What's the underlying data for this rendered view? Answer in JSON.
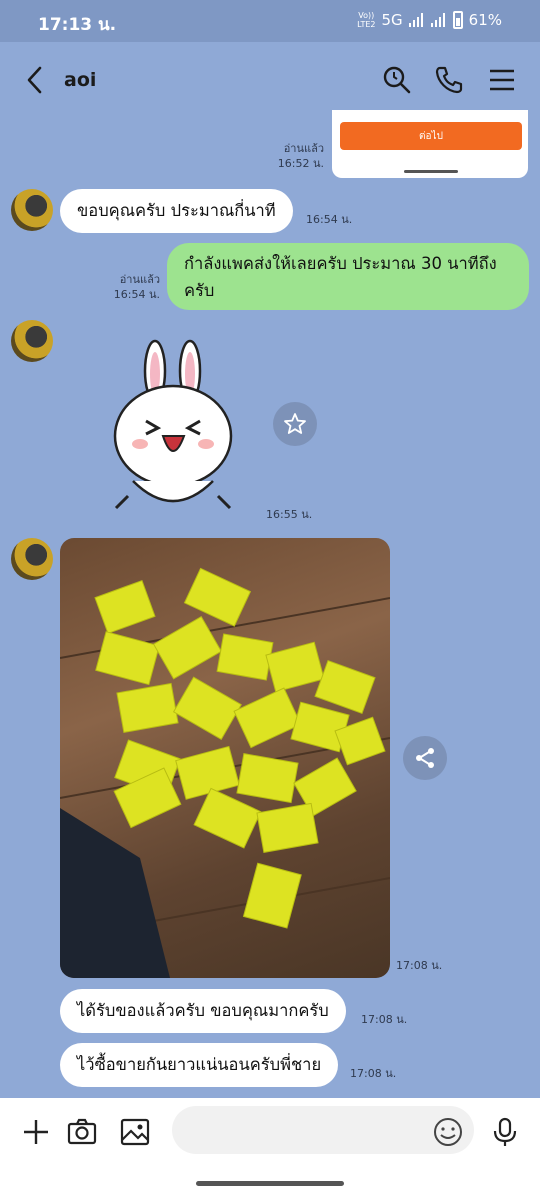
{
  "status_bar": {
    "time": "17:13 น.",
    "volte": "Vo))",
    "lte": "LTE2",
    "network": "5G",
    "battery": "61%"
  },
  "header": {
    "title": "aoi"
  },
  "popup": {
    "button_label": "ต่อไป"
  },
  "messages": [
    {
      "meta_read": "อ่านแล้ว",
      "meta_time": "16:52 น."
    },
    {
      "text": "ขอบคุณครับ ประมาณกี่นาที",
      "time": "16:54 น."
    },
    {
      "text_line1": "กำลังแพคส่งให้เลยครับ ประมาณ 30 นาทีถึง",
      "text_line2": "ครับ",
      "read": "อ่านแล้ว",
      "time": "16:54 น."
    },
    {
      "time": "16:55 น."
    },
    {
      "time": "17:08 น."
    },
    {
      "text": "ได้รับของแล้วครับ ขอบคุณมากครับ",
      "time": "17:08 น."
    },
    {
      "text": "ไว้ซื้อขายกันยาวแน่นอนครับพี่ชาย",
      "time": "17:08 น."
    }
  ],
  "input_bar": {
    "placeholder": ""
  },
  "colors": {
    "chat_background": "#8fa9d6",
    "incoming_bubble": "#ffffff",
    "outgoing_bubble": "#9de38f",
    "accent_orange": "#f26a21"
  },
  "icons": [
    "back-icon",
    "search-icon",
    "phone-icon",
    "menu-icon",
    "star-icon",
    "share-icon",
    "plus-icon",
    "camera-icon",
    "image-icon",
    "emoji-icon",
    "mic-icon"
  ]
}
